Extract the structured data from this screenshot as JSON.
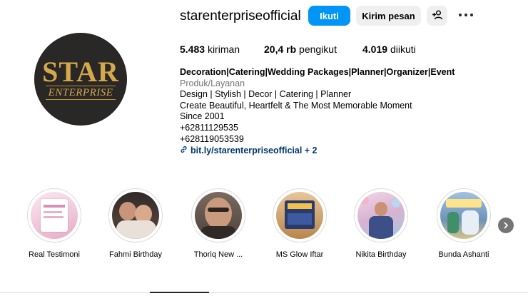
{
  "profile": {
    "username": "starenterpriseofficial",
    "logo_text_line1": "STAR",
    "logo_text_line2": "ENTERPRISE"
  },
  "actions": {
    "follow_label": "Ikuti",
    "message_label": "Kirim pesan",
    "add_user_icon": "add-user-icon",
    "more_icon": "more-options-icon"
  },
  "stats": {
    "posts_count": "5.483",
    "posts_label": "kiriman",
    "followers_count": "20,4 rb",
    "followers_label": "pengikut",
    "following_count": "4.019",
    "following_label": "diikuti"
  },
  "bio": {
    "name": "Decoration|Catering|Wedding Packages|Planner|Organizer|Event",
    "category": "Produk/Layanan",
    "lines": [
      "Design | Stylish | Decor | Catering | Planner",
      "Create Beautiful, Heartfelt & The Most Memorable Moment",
      "Since 2001",
      "+62811129535",
      "+628119053539"
    ],
    "link_text": "bit.ly/starenterpriseofficial + 2"
  },
  "highlights": [
    {
      "label": "Real Testimoni",
      "color": "#f3d6e4"
    },
    {
      "label": "Fahmi Birthday",
      "color": "#3a2f2d"
    },
    {
      "label": "Thoriq New ...",
      "color": "#5a4a42"
    },
    {
      "label": "MS Glow Iftar",
      "color": "#b9864a"
    },
    {
      "label": "Nikita Birthday",
      "color": "#c9a9c6"
    },
    {
      "label": "Bunda Ashanti",
      "color": "#7fa4c9"
    }
  ],
  "colors": {
    "accent": "#0095f6",
    "link": "#00376b",
    "muted": "#737373",
    "logo_gold": "#d4a94d"
  }
}
